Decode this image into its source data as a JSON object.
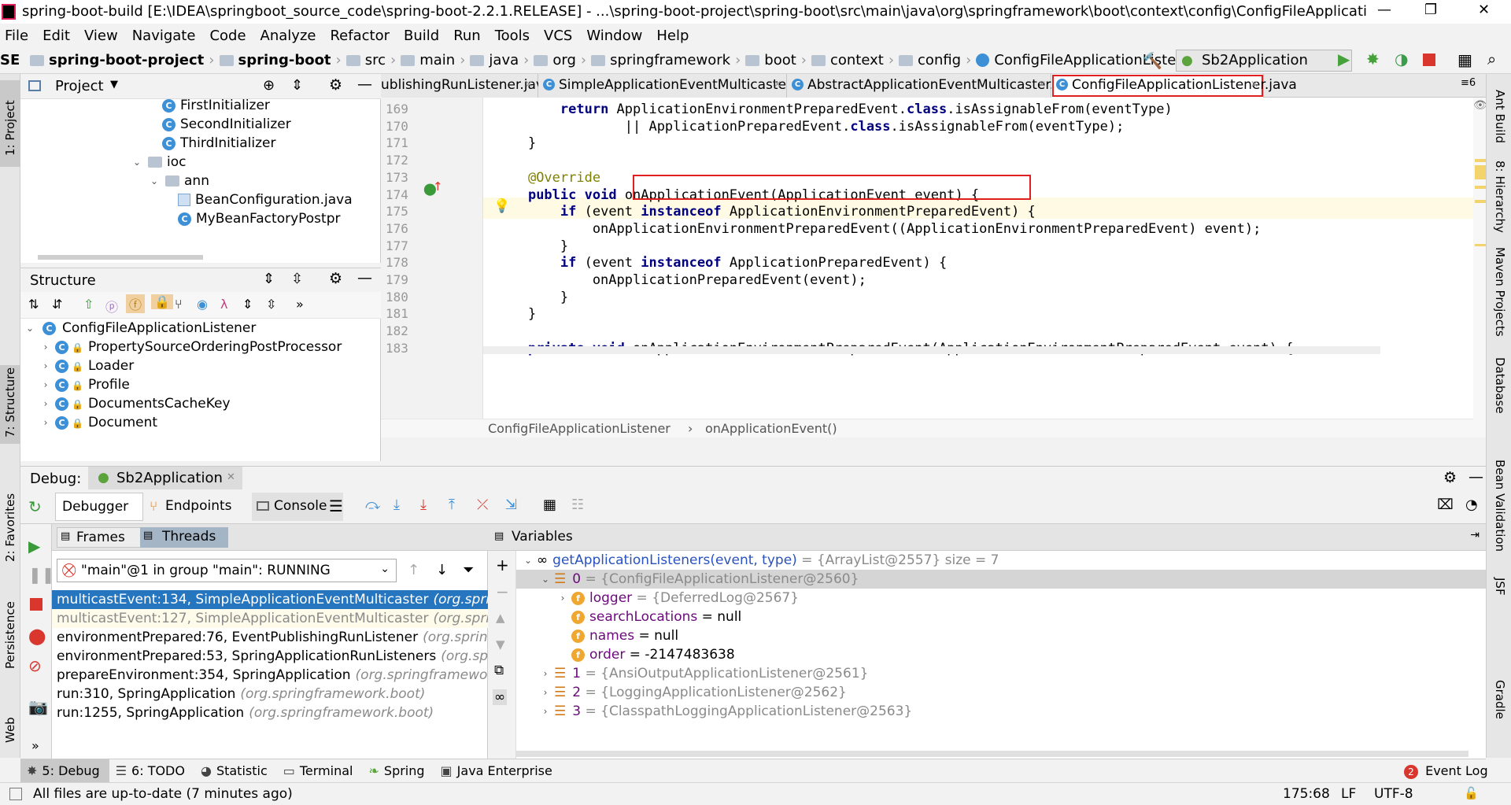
{
  "title_bar": {
    "title": "spring-boot-build [E:\\IDEA\\springboot_source_code\\spring-boot-2.2.1.RELEASE] - ...\\spring-boot-project\\spring-boot\\src\\main\\java\\org\\springframework\\boot\\context\\config\\ConfigFileApplicationListener.j...",
    "minimize": "—",
    "restore": "❐",
    "close": "✕"
  },
  "menu": [
    "File",
    "Edit",
    "View",
    "Navigate",
    "Code",
    "Analyze",
    "Refactor",
    "Build",
    "Run",
    "Tools",
    "VCS",
    "Window",
    "Help"
  ],
  "breadcrumb": {
    "prefix": "SE",
    "items": [
      "spring-boot-project",
      "spring-boot",
      "src",
      "main",
      "java",
      "org",
      "springframework",
      "boot",
      "context",
      "config",
      "ConfigFileApplicationListener"
    ],
    "run_config": "Sb2Application"
  },
  "project_panel": {
    "title": "Project",
    "tree": [
      {
        "label": "FirstInitializer",
        "kind": "class"
      },
      {
        "label": "SecondInitializer",
        "kind": "class"
      },
      {
        "label": "ThirdInitializer",
        "kind": "class"
      },
      {
        "label": "ioc",
        "kind": "folder"
      },
      {
        "label": "ann",
        "kind": "folder"
      },
      {
        "label": "BeanConfiguration.java",
        "kind": "file"
      },
      {
        "label": "MyBeanFactoryPostpr",
        "kind": "class"
      }
    ]
  },
  "structure_panel": {
    "title": "Structure",
    "root": "ConfigFileApplicationListener",
    "items": [
      "PropertySourceOrderingPostProcessor",
      "Loader",
      "Profile",
      "DocumentsCacheKey",
      "Document"
    ]
  },
  "editor": {
    "tabs": [
      {
        "label": "ublishingRunListener.java",
        "active": false
      },
      {
        "label": "SimpleApplicationEventMulticaster.java",
        "active": false
      },
      {
        "label": "AbstractApplicationEventMulticaster.java",
        "active": false
      },
      {
        "label": "ConfigFileApplicationListener.java",
        "active": true
      }
    ],
    "tab_overflow": "≡6",
    "lines": [
      {
        "n": "169",
        "code": "        return ApplicationEnvironmentPreparedEvent.class.isAssignableFrom(eventType)"
      },
      {
        "n": "170",
        "code": "                || ApplicationPreparedEvent.class.isAssignableFrom(eventType);"
      },
      {
        "n": "171",
        "code": "    }"
      },
      {
        "n": "172",
        "code": ""
      },
      {
        "n": "173",
        "code": "    @Override"
      },
      {
        "n": "174",
        "code": "    public void onApplicationEvent(ApplicationEvent event) {"
      },
      {
        "n": "175",
        "code": "        if (event instanceof ApplicationEnvironmentPreparedEvent) {"
      },
      {
        "n": "176",
        "code": "            onApplicationEnvironmentPreparedEvent((ApplicationEnvironmentPreparedEvent) event);"
      },
      {
        "n": "177",
        "code": "        }"
      },
      {
        "n": "178",
        "code": "        if (event instanceof ApplicationPreparedEvent) {"
      },
      {
        "n": "179",
        "code": "            onApplicationPreparedEvent(event);"
      },
      {
        "n": "180",
        "code": "        }"
      },
      {
        "n": "181",
        "code": "    }"
      },
      {
        "n": "182",
        "code": ""
      },
      {
        "n": "183",
        "code": "    private void onApplicationEnvironmentPreparedEvent(ApplicationEnvironmentPreparedEvent event) {"
      }
    ],
    "crumb": [
      "ConfigFileApplicationListener",
      "onApplicationEvent()"
    ]
  },
  "debug": {
    "label": "Debug:",
    "session": "Sb2Application",
    "tabs": [
      "Debugger",
      "Endpoints",
      "Console"
    ],
    "frames_tab": "Frames",
    "threads_tab": "Threads",
    "thread_select": "\"main\"@1 in group \"main\": RUNNING",
    "frames": [
      {
        "method": "multicastEvent:134, SimpleApplicationEventMulticaster",
        "pkg": "(org.spring",
        "state": "selected"
      },
      {
        "method": "multicastEvent:127, SimpleApplicationEventMulticaster",
        "pkg": "(org.spring",
        "state": "dim"
      },
      {
        "method": "environmentPrepared:76, EventPublishingRunListener",
        "pkg": "(org.springf",
        "state": "normal"
      },
      {
        "method": "environmentPrepared:53, SpringApplicationRunListeners",
        "pkg": "(org.spri",
        "state": "normal"
      },
      {
        "method": "prepareEnvironment:354, SpringApplication",
        "pkg": "(org.springframework",
        "state": "normal"
      },
      {
        "method": "run:310, SpringApplication",
        "pkg": "(org.springframework.boot)",
        "state": "normal"
      },
      {
        "method": "run:1255, SpringApplication",
        "pkg": "(org.springframework.boot)",
        "state": "normal"
      }
    ],
    "variables_title": "Variables",
    "variables": [
      {
        "indent": 0,
        "expander": "⌄",
        "icon": "oo",
        "name": "getApplicationListeners(event, type)",
        "value": " = {ArrayList@2557}  size = 7"
      },
      {
        "indent": 1,
        "expander": "⌄",
        "icon": "list",
        "name": "0",
        "value": " = {ConfigFileApplicationListener@2560}"
      },
      {
        "indent": 2,
        "expander": "›",
        "icon": "f",
        "name": "logger",
        "value": " = {DeferredLog@2567}"
      },
      {
        "indent": 2,
        "expander": "",
        "icon": "f",
        "name": "searchLocations",
        "value": " = null"
      },
      {
        "indent": 2,
        "expander": "",
        "icon": "f",
        "name": "names",
        "value": " = null"
      },
      {
        "indent": 2,
        "expander": "",
        "icon": "f",
        "name": "order",
        "value": " = -2147483638"
      },
      {
        "indent": 1,
        "expander": "›",
        "icon": "list",
        "name": "1",
        "value": " = {AnsiOutputApplicationListener@2561}"
      },
      {
        "indent": 1,
        "expander": "›",
        "icon": "list",
        "name": "2",
        "value": " = {LoggingApplicationListener@2562}"
      },
      {
        "indent": 1,
        "expander": "›",
        "icon": "list",
        "name": "3",
        "value": " = {ClasspathLoggingApplicationListener@2563}"
      }
    ]
  },
  "left_strip": [
    "1: Project",
    "7: Structure",
    "2: Favorites",
    "Persistence",
    "Web"
  ],
  "right_strip": [
    "Ant Build",
    "8: Hierarchy",
    "Maven Projects",
    "Database",
    "Bean Validation",
    "JSF",
    "Gradle"
  ],
  "bottom_tools": [
    "5: Debug",
    "6: TODO",
    "Statistic",
    "Terminal",
    "Spring",
    "Java Enterprise"
  ],
  "event_log": {
    "count": "2",
    "label": "Event Log"
  },
  "status": {
    "message": "All files are up-to-date (7 minutes ago)",
    "position": "175:68",
    "line_sep": "LF",
    "encoding": "UTF-8"
  },
  "colors": {
    "accent": "#2675bf",
    "highlight_box": "#e02020",
    "keyword": "#000080",
    "annotation": "#808000"
  }
}
